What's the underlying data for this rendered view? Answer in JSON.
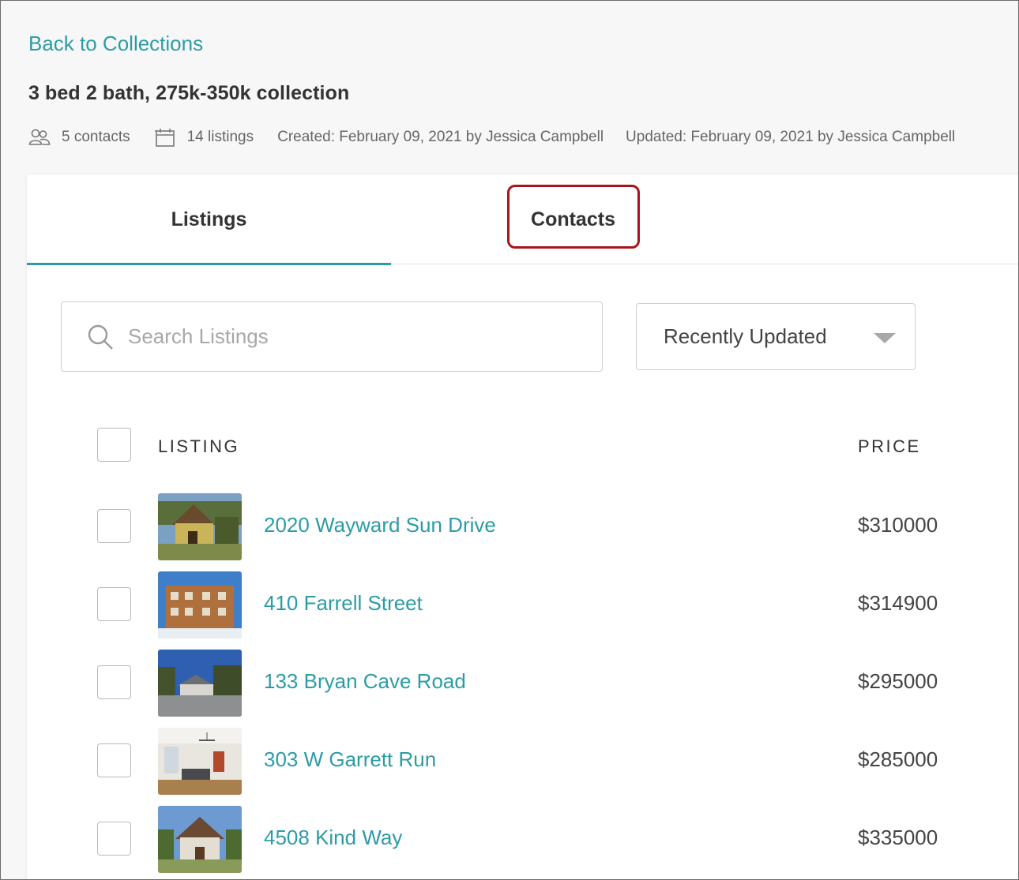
{
  "nav": {
    "back_label": "Back to Collections"
  },
  "collection": {
    "title": "3 bed 2 bath, 275k-350k collection",
    "contacts_count": "5 contacts",
    "listings_count": "14 listings",
    "created": "Created: February 09, 2021 by Jessica Campbell",
    "updated": "Updated: February 09, 2021 by Jessica Campbell"
  },
  "tabs": [
    {
      "label": "Listings",
      "active": true
    },
    {
      "label": "Contacts",
      "active": false
    }
  ],
  "search": {
    "placeholder": "Search Listings",
    "value": ""
  },
  "sort": {
    "selected": "Recently Updated"
  },
  "table": {
    "headers": {
      "listing": "LISTING",
      "price": "PRICE"
    },
    "rows": [
      {
        "address": "2020 Wayward Sun Drive",
        "price": "$310000"
      },
      {
        "address": "410 Farrell Street",
        "price": "$314900"
      },
      {
        "address": "133 Bryan Cave Road",
        "price": "$295000"
      },
      {
        "address": "303 W Garrett Run",
        "price": "$285000"
      },
      {
        "address": "4508 Kind Way",
        "price": "$335000"
      }
    ]
  },
  "colors": {
    "accent": "#2b9ca6",
    "highlight": "#a8141b"
  }
}
